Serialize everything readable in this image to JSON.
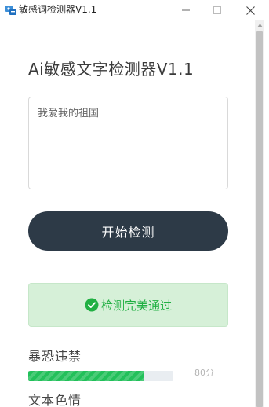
{
  "window": {
    "title": "敏感词检测器V1.1"
  },
  "app": {
    "title": "Ai敏感文字检测器V1.1"
  },
  "input": {
    "value": "我爱我的祖国"
  },
  "start_button": {
    "label": "开始检测"
  },
  "result": {
    "message": "检测完美通过",
    "color": "#21b043",
    "background": "#d6f0d8"
  },
  "categories": [
    {
      "label": "暴恐违禁",
      "score_text": "80分",
      "progress_percent": 80,
      "bar_color": "#22c05a"
    },
    {
      "label": "文本色情"
    }
  ],
  "colors": {
    "primary_button": "#2d3a47"
  }
}
